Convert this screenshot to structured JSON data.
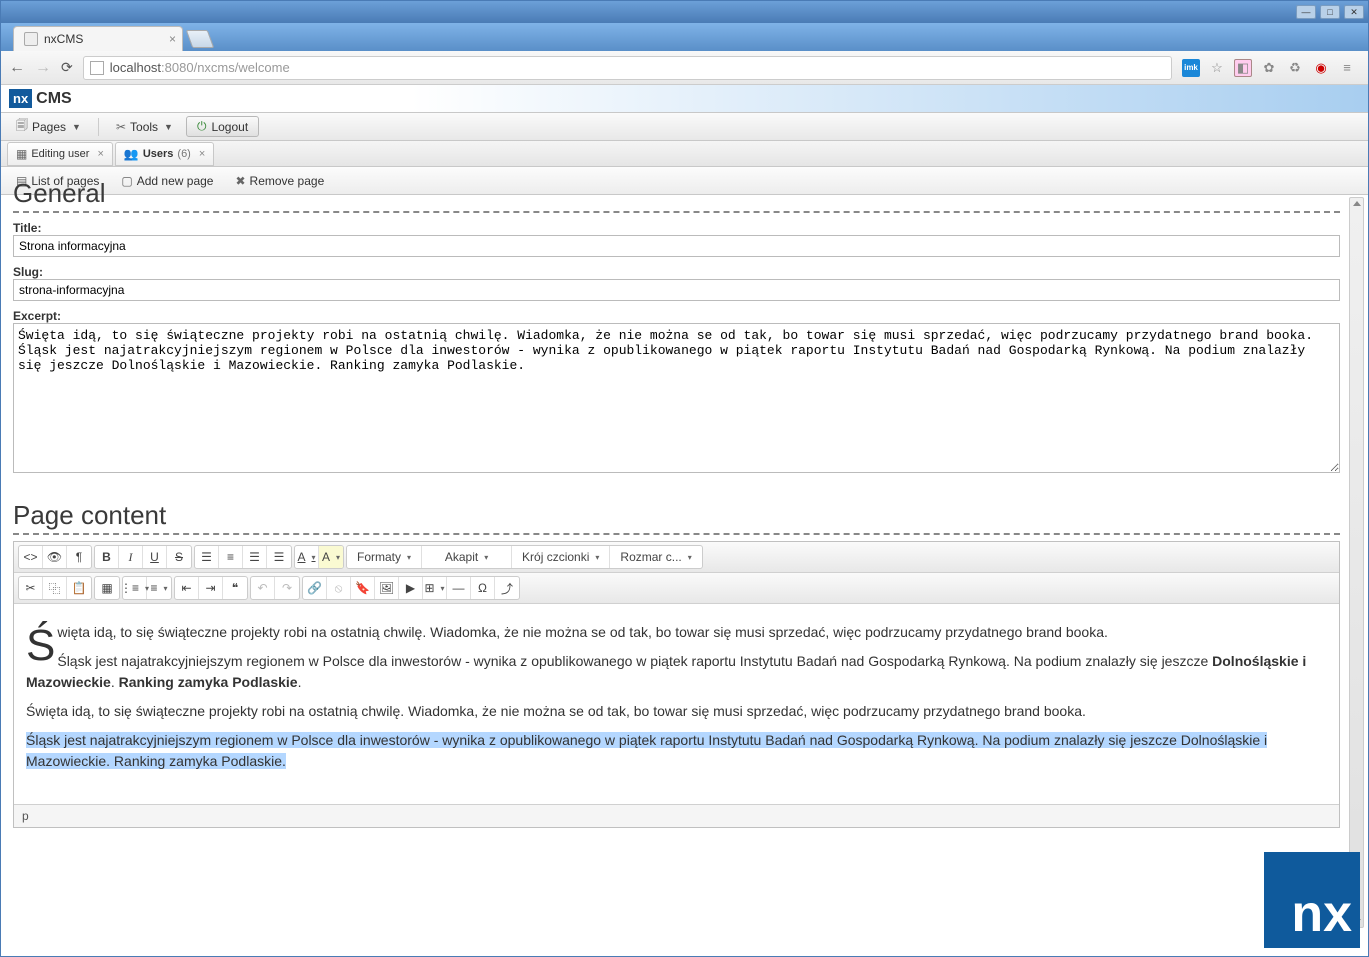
{
  "browser": {
    "tab_title": "nxCMS",
    "url_host": "localhost",
    "url_port": ":8080",
    "url_path": "/nxcms/welcome"
  },
  "app": {
    "logo_prefix": "nx",
    "logo_text": "CMS"
  },
  "main_toolbar": {
    "pages": "Pages",
    "tools": "Tools",
    "logout": "Logout"
  },
  "page_tabs": {
    "editing_user": "Editing user",
    "users": "Users",
    "users_count": "(6)"
  },
  "sub_toolbar": {
    "list_pages": "List of pages",
    "add_page": "Add new page",
    "remove_page": "Remove page"
  },
  "sections": {
    "general": "General",
    "page_content": "Page content"
  },
  "fields": {
    "title_label": "Title:",
    "title_value": "Strona informacyjna",
    "slug_label": "Slug:",
    "slug_value": "strona-informacyjna",
    "excerpt_label": "Excerpt:",
    "excerpt_value": "Święta idą, to się świąteczne projekty robi na ostatnią chwilę. Wiadomka, że nie można se od tak, bo towar się musi sprzedać, więc podrzucamy przydatnego brand booka.\nŚląsk jest najatrakcyjniejszym regionem w Polsce dla inwestorów - wynika z opublikowanego w piątek raportu Instytutu Badań nad Gospodarką Rynkową. Na podium znalazły się jeszcze Dolnośląskie i Mazowieckie. Ranking zamyka Podlaskie."
  },
  "editor": {
    "dropdowns": {
      "formats": "Formaty",
      "paragraph": "Akapit",
      "font": "Krój czcionki",
      "size": "Rozmar c..."
    },
    "content": {
      "p1": "Święta idą, to się świąteczne projekty robi na ostatnią chwilę. Wiadomka, że nie można se od tak, bo towar się musi sprzedać, więc podrzucamy przydatnego brand booka.",
      "p2_before": "Śląsk jest najatrakcyjniejszym regionem w Polsce dla inwestorów - wynika z opublikowanego w piątek raportu Instytutu Badań nad Gospodarką Rynkową. Na podium znalazły się jeszcze ",
      "p2_bold1": "Dolnośląskie i Mazowieckie",
      "p2_mid": ". ",
      "p2_bold2": "Ranking zamyka Podlaskie",
      "p2_after": ".",
      "p3": "Święta idą, to się świąteczne projekty robi na ostatnią chwilę. Wiadomka, że nie można se od tak, bo towar się musi sprzedać, więc podrzucamy przydatnego brand booka.",
      "p4_selected": "Śląsk jest najatrakcyjniejszym regionem w Polsce dla inwestorów - wynika z opublikowanego w piątek raportu Instytutu Badań nad Gospodarką Rynkową. Na podium znalazły się jeszcze Dolnośląskie i Mazowieckie. Ranking zamyka Podlaskie."
    },
    "status_path": "p"
  },
  "big_logo": "nx"
}
